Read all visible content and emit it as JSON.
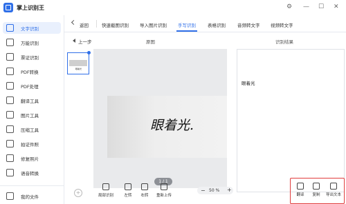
{
  "app": {
    "title": "掌上识别王",
    "window_controls": [
      "⚙",
      "—",
      "☐",
      "✕"
    ]
  },
  "sidebar": {
    "items": [
      {
        "label": "文字识别",
        "icon": "text-scan-icon",
        "active": true
      },
      {
        "label": "万能识别",
        "icon": "universal-scan-icon"
      },
      {
        "label": "票证识别",
        "icon": "ticket-icon"
      },
      {
        "label": "PDF转换",
        "icon": "pdf-convert-icon"
      },
      {
        "label": "PDF处理",
        "icon": "pdf-process-icon"
      },
      {
        "label": "翻译工具",
        "icon": "translate-icon"
      },
      {
        "label": "图片工具",
        "icon": "image-tool-icon"
      },
      {
        "label": "压缩工具",
        "icon": "compress-icon"
      },
      {
        "label": "拍证件照",
        "icon": "id-photo-icon"
      },
      {
        "label": "修复照片",
        "icon": "repair-photo-icon"
      },
      {
        "label": "语音转换",
        "icon": "voice-convert-icon"
      }
    ],
    "my_files": {
      "label": "我的文件",
      "icon": "folder-icon"
    }
  },
  "tabs": {
    "back_label": "返回",
    "items": [
      "快速截图识别",
      "导入图片识别",
      "手写识别",
      "表格识别",
      "音频转文字",
      "视频转文字"
    ],
    "active": "手写识别"
  },
  "workspace": {
    "prev_step": "上一步",
    "original_label": "原图",
    "result_label": "识别结果",
    "handwriting": "眼着光.",
    "thumbnail_text": "眼着光",
    "page_indicator": "1 / 1",
    "result_text": "眼着光"
  },
  "toolbar": {
    "tools": [
      {
        "label": "局部识别",
        "icon": "crop-icon"
      },
      {
        "label": "左转",
        "icon": "rotate-left-icon"
      },
      {
        "label": "右转",
        "icon": "rotate-right-icon"
      },
      {
        "label": "重新上传",
        "icon": "reupload-icon"
      }
    ],
    "zoom": {
      "minus": "−",
      "value": "50 %",
      "plus": "+"
    }
  },
  "actions": [
    {
      "label": "翻译",
      "icon": "translate-doc-icon"
    },
    {
      "label": "复制",
      "icon": "copy-icon"
    },
    {
      "label": "导出文本",
      "icon": "export-icon"
    }
  ],
  "colors": {
    "accent": "#2f6fe8",
    "highlight_box": "#e03b3b"
  }
}
